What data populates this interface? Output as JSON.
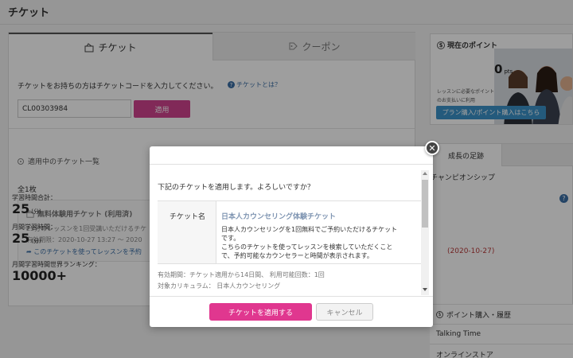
{
  "page": {
    "title": "チケット"
  },
  "tabs": {
    "ticket_label": "チケット",
    "coupon_label": "クーポン"
  },
  "ticket_entry": {
    "intro": "チケットをお持ちの方はチケットコードを入力してください。",
    "help_link": "チケットとは？",
    "code_value": "CL00303984",
    "apply_label": "適用"
  },
  "active_tickets": {
    "heading": "適用中のチケット一覧",
    "total": "全1枚",
    "item": {
      "name": "無料体験用チケット (利用済)",
      "desc": "25分のレッスンを1回受講いただけるチケ",
      "expiry": "有効期限：2020-10-27 13:27 ～ 2020",
      "link": "このチケットを使ってレッスンを予約"
    }
  },
  "points": {
    "title": "現在のポイント",
    "value": "0",
    "unit": "pts",
    "note1": "レッスンに必要なポイント",
    "note2": "のお支払いに利用",
    "purchase_label": "プラン購入/ポイント購入はこちら"
  },
  "record": {
    "tab_label": "成長の足跡",
    "champion_label": "チャンピオンシップ",
    "total_time_label": "学習時間合計：",
    "total_time_value": "25",
    "total_time_unit": "(分)",
    "monthly_label": "月間学習時間：",
    "monthly_value": "25",
    "monthly_unit": "(分)",
    "monthly_date": "(2020-10-27)",
    "ranking_label": "月間学習時間世界ランキング：",
    "ranking_value": "10000+"
  },
  "sidebar_history": {
    "history_label": "ポイント購入・履歴",
    "talking_time": "Talking Time",
    "online_store": "オンラインストア"
  },
  "modal": {
    "confirm_text": "下記のチケットを適用します。よろしいですか？",
    "label_name": "チケット名",
    "ticket_name": "日本人カウンセリング体験チケット",
    "desc_lines": [
      "日本人カウンセリングを1回無料でご予約いただけるチケット",
      "です。",
      "こちらのチケットを使ってレッスンを検索していただくこと",
      "で、予約可能なカウンセラーと時間が表示されます。"
    ],
    "validity": "有効期間：チケット適用から14日間、 利用可能回数：1回",
    "target": "対象カリキュラム： 日本人カウンセリング",
    "confirm_button": "チケットを適用する",
    "cancel_button": "キャンセル"
  },
  "colors": {
    "accent_pink": "#e0378f",
    "link_blue": "#3b6ea5",
    "button_blue": "#3a92c8"
  }
}
